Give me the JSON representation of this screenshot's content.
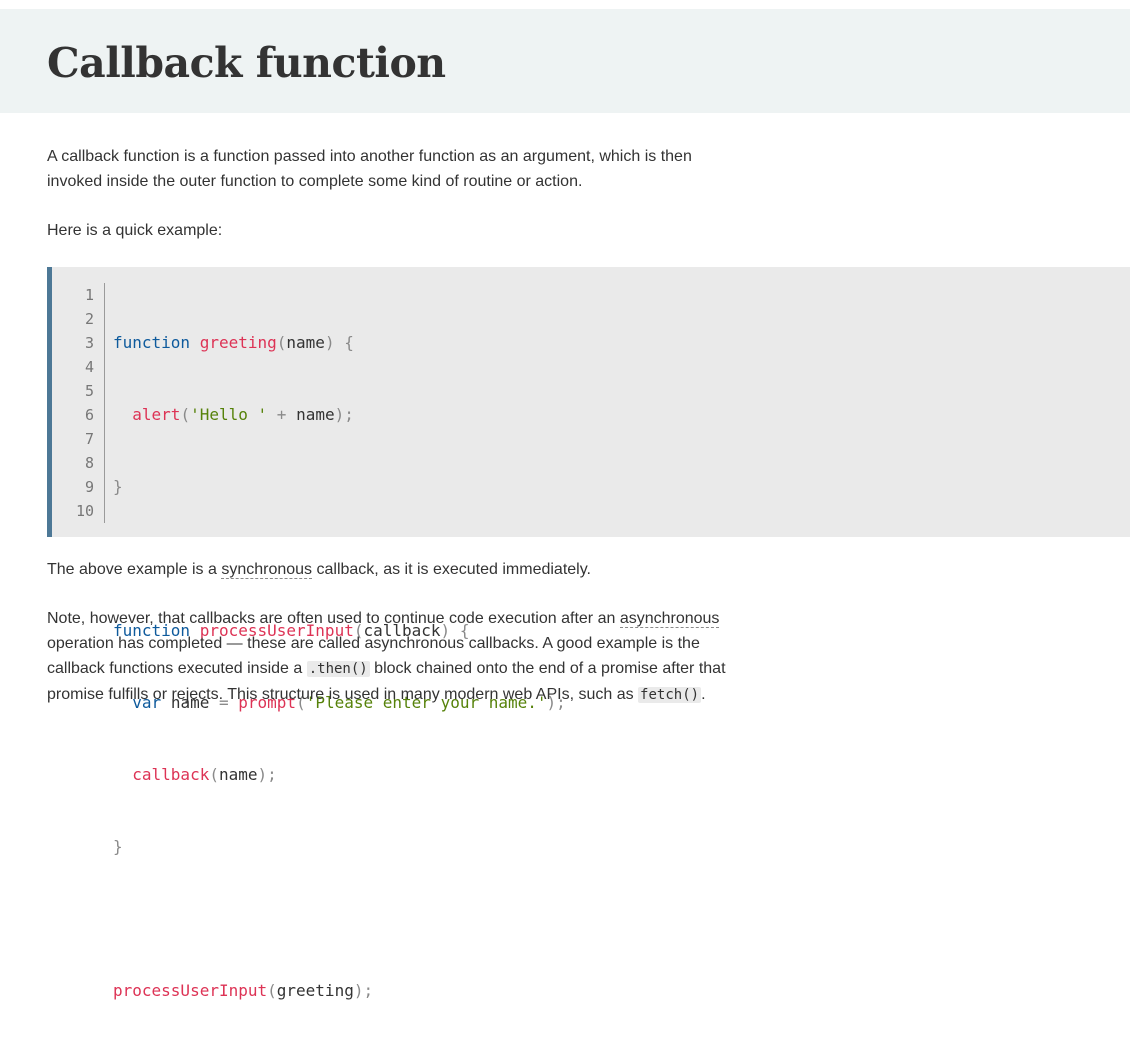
{
  "page": {
    "title": "Callback function"
  },
  "paragraphs": {
    "intro": "A callback function is a function passed into another function as an argument, which is then invoked inside the outer function to complete some kind of routine or action.",
    "example_intro": "Here is a quick example:",
    "sync_before": "The above example is a ",
    "sync_link": "synchronous",
    "sync_after": " callback, as it is executed immediately.",
    "note_before": "Note, however, that callbacks are often used to continue code execution after an ",
    "note_link": "asynchronous",
    "note_middle": " operation has completed — these are called asynchronous callbacks. A good example is the callback functions executed inside a ",
    "note_code1": ".then()",
    "note_middle2": " block chained onto the end of a promise after that promise fulfills or rejects. This structure is used in many modern web APIs, such as ",
    "note_code2": "fetch()",
    "note_end": "."
  },
  "code_example": {
    "line_numbers": [
      "1",
      "2",
      "3",
      "4",
      "5",
      "6",
      "7",
      "8",
      "9",
      "10"
    ],
    "lines": [
      "function greeting(name) {",
      "  alert('Hello ' + name);",
      "}",
      "",
      "function processUserInput(callback) {",
      "  var name = prompt('Please enter your name.');",
      "  callback(name);",
      "}",
      "",
      "processUserInput(greeting);"
    ]
  },
  "colors": {
    "keyword": "#0e5a9c",
    "function_name": "#dd3355",
    "string": "#56820a",
    "punctuation": "#8a8a8a",
    "code_border": "#4d7896",
    "code_background": "#eaeaea",
    "title_band": "#eef3f3"
  }
}
